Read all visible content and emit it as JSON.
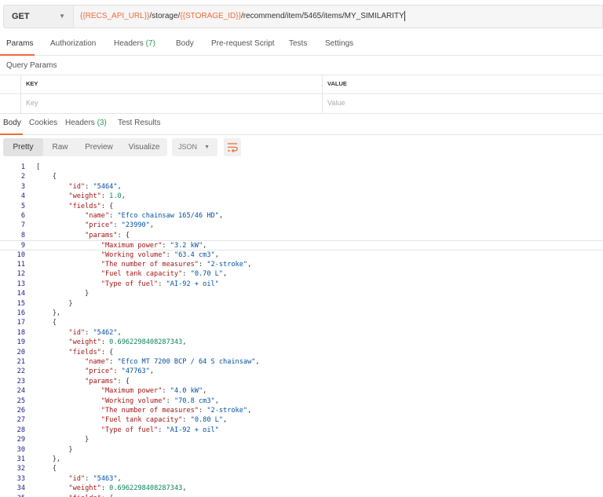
{
  "request": {
    "method": "GET",
    "url_parts": [
      {
        "text": "{{RECS_API_URL}}",
        "var": true
      },
      {
        "text": "/storage/",
        "var": false
      },
      {
        "text": "{{STORAGE_ID}}",
        "var": true
      },
      {
        "text": "/recommend/item/5465/items/MY_SIMILARITY",
        "var": false
      }
    ]
  },
  "request_tabs": [
    {
      "label": "Params",
      "count": ""
    },
    {
      "label": "Authorization",
      "count": ""
    },
    {
      "label": "Headers ",
      "count": "(7)"
    },
    {
      "label": "Body",
      "count": ""
    },
    {
      "label": "Pre-request Script",
      "count": ""
    },
    {
      "label": "Tests",
      "count": ""
    },
    {
      "label": "Settings",
      "count": ""
    }
  ],
  "query_params": {
    "title": "Query Params",
    "key_header": "KEY",
    "value_header": "VALUE",
    "key_placeholder": "Key",
    "value_placeholder": "Value"
  },
  "response_tabs": [
    {
      "label": "Body",
      "count": ""
    },
    {
      "label": "Cookies",
      "count": ""
    },
    {
      "label": "Headers ",
      "count": "(3)"
    },
    {
      "label": "Test Results",
      "count": ""
    }
  ],
  "view_modes": [
    "Pretty",
    "Raw",
    "Preview",
    "Visualize"
  ],
  "format": "JSON",
  "colors": {
    "accent": "#f26b3a",
    "key": "#a31515",
    "string": "#0451a5",
    "number": "#098658"
  },
  "code_lines": [
    [
      [
        "p",
        "["
      ]
    ],
    [
      [
        "p",
        "    {"
      ]
    ],
    [
      [
        "p",
        "        "
      ],
      [
        "k",
        "\"id\""
      ],
      [
        "p",
        ": "
      ],
      [
        "s",
        "\"5464\""
      ],
      [
        "p",
        ","
      ]
    ],
    [
      [
        "p",
        "        "
      ],
      [
        "k",
        "\"weight\""
      ],
      [
        "p",
        ": "
      ],
      [
        "n",
        "1.0"
      ],
      [
        "p",
        ","
      ]
    ],
    [
      [
        "p",
        "        "
      ],
      [
        "k",
        "\"fields\""
      ],
      [
        "p",
        ": {"
      ]
    ],
    [
      [
        "p",
        "            "
      ],
      [
        "k",
        "\"name\""
      ],
      [
        "p",
        ": "
      ],
      [
        "s",
        "\"Efco chainsaw 165/46 HD\""
      ],
      [
        "p",
        ","
      ]
    ],
    [
      [
        "p",
        "            "
      ],
      [
        "k",
        "\"price\""
      ],
      [
        "p",
        ": "
      ],
      [
        "s",
        "\"23990\""
      ],
      [
        "p",
        ","
      ]
    ],
    [
      [
        "p",
        "            "
      ],
      [
        "k",
        "\"params\""
      ],
      [
        "p",
        ": {"
      ]
    ],
    [
      [
        "p",
        "                "
      ],
      [
        "k",
        "\"Maximum power\""
      ],
      [
        "p",
        ": "
      ],
      [
        "s",
        "\"3.2 kW\""
      ],
      [
        "p",
        ","
      ]
    ],
    [
      [
        "p",
        "                "
      ],
      [
        "k",
        "\"Working volume\""
      ],
      [
        "p",
        ": "
      ],
      [
        "s",
        "\"63.4 cm3\""
      ],
      [
        "p",
        ","
      ]
    ],
    [
      [
        "p",
        "                "
      ],
      [
        "k",
        "\"The number of measures\""
      ],
      [
        "p",
        ": "
      ],
      [
        "s",
        "\"2-stroke\""
      ],
      [
        "p",
        ","
      ]
    ],
    [
      [
        "p",
        "                "
      ],
      [
        "k",
        "\"Fuel tank capacity\""
      ],
      [
        "p",
        ": "
      ],
      [
        "s",
        "\"0.70 L\""
      ],
      [
        "p",
        ","
      ]
    ],
    [
      [
        "p",
        "                "
      ],
      [
        "k",
        "\"Type of fuel\""
      ],
      [
        "p",
        ": "
      ],
      [
        "s",
        "\"AI-92 + oil\""
      ]
    ],
    [
      [
        "p",
        "            }"
      ]
    ],
    [
      [
        "p",
        "        }"
      ]
    ],
    [
      [
        "p",
        "    },"
      ]
    ],
    [
      [
        "p",
        "    {"
      ]
    ],
    [
      [
        "p",
        "        "
      ],
      [
        "k",
        "\"id\""
      ],
      [
        "p",
        ": "
      ],
      [
        "s",
        "\"5462\""
      ],
      [
        "p",
        ","
      ]
    ],
    [
      [
        "p",
        "        "
      ],
      [
        "k",
        "\"weight\""
      ],
      [
        "p",
        ": "
      ],
      [
        "n",
        "0.6962298408287343"
      ],
      [
        "p",
        ","
      ]
    ],
    [
      [
        "p",
        "        "
      ],
      [
        "k",
        "\"fields\""
      ],
      [
        "p",
        ": {"
      ]
    ],
    [
      [
        "p",
        "            "
      ],
      [
        "k",
        "\"name\""
      ],
      [
        "p",
        ": "
      ],
      [
        "s",
        "\"Efco MT 7200 BCP / 64 S chainsaw\""
      ],
      [
        "p",
        ","
      ]
    ],
    [
      [
        "p",
        "            "
      ],
      [
        "k",
        "\"price\""
      ],
      [
        "p",
        ": "
      ],
      [
        "s",
        "\"47763\""
      ],
      [
        "p",
        ","
      ]
    ],
    [
      [
        "p",
        "            "
      ],
      [
        "k",
        "\"params\""
      ],
      [
        "p",
        ": {"
      ]
    ],
    [
      [
        "p",
        "                "
      ],
      [
        "k",
        "\"Maximum power\""
      ],
      [
        "p",
        ": "
      ],
      [
        "s",
        "\"4.0 kW\""
      ],
      [
        "p",
        ","
      ]
    ],
    [
      [
        "p",
        "                "
      ],
      [
        "k",
        "\"Working volume\""
      ],
      [
        "p",
        ": "
      ],
      [
        "s",
        "\"70.8 cm3\""
      ],
      [
        "p",
        ","
      ]
    ],
    [
      [
        "p",
        "                "
      ],
      [
        "k",
        "\"The number of measures\""
      ],
      [
        "p",
        ": "
      ],
      [
        "s",
        "\"2-stroke\""
      ],
      [
        "p",
        ","
      ]
    ],
    [
      [
        "p",
        "                "
      ],
      [
        "k",
        "\"Fuel tank capacity\""
      ],
      [
        "p",
        ": "
      ],
      [
        "s",
        "\"0.80 L\""
      ],
      [
        "p",
        ","
      ]
    ],
    [
      [
        "p",
        "                "
      ],
      [
        "k",
        "\"Type of fuel\""
      ],
      [
        "p",
        ": "
      ],
      [
        "s",
        "\"AI-92 + oil\""
      ]
    ],
    [
      [
        "p",
        "            }"
      ]
    ],
    [
      [
        "p",
        "        }"
      ]
    ],
    [
      [
        "p",
        "    },"
      ]
    ],
    [
      [
        "p",
        "    {"
      ]
    ],
    [
      [
        "p",
        "        "
      ],
      [
        "k",
        "\"id\""
      ],
      [
        "p",
        ": "
      ],
      [
        "s",
        "\"5463\""
      ],
      [
        "p",
        ","
      ]
    ],
    [
      [
        "p",
        "        "
      ],
      [
        "k",
        "\"weight\""
      ],
      [
        "p",
        ": "
      ],
      [
        "n",
        "0.6962298408287343"
      ],
      [
        "p",
        ","
      ]
    ],
    [
      [
        "p",
        "        "
      ],
      [
        "k",
        "\"fields\""
      ],
      [
        "p",
        ": {"
      ]
    ]
  ]
}
